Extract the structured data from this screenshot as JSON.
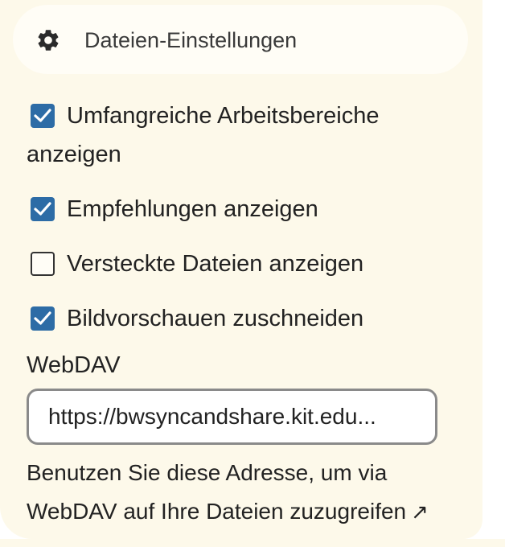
{
  "header": {
    "label": "Dateien-Einstellungen",
    "icon": "gear-icon"
  },
  "options": [
    {
      "label_line1": "Umfangreiche Arbeitsbereiche",
      "label_line2": "anzeigen",
      "checked": true
    },
    {
      "label": "Empfehlungen anzeigen",
      "checked": true
    },
    {
      "label": "Versteckte Dateien anzeigen",
      "checked": false
    },
    {
      "label": "Bildvorschauen zuschneiden",
      "checked": true
    }
  ],
  "webdav": {
    "title": "WebDAV",
    "url_display": "https://bwsyncandshare.kit.edu...",
    "help_line1": "Benutzen Sie diese Adresse, um via",
    "help_line2": "WebDAV auf Ihre Dateien zuzugreifen",
    "link_icon": "external-link-arrow-icon"
  },
  "colors": {
    "panel_bg": "#fdf9ea",
    "checkbox_checked": "#2d6ca6"
  }
}
